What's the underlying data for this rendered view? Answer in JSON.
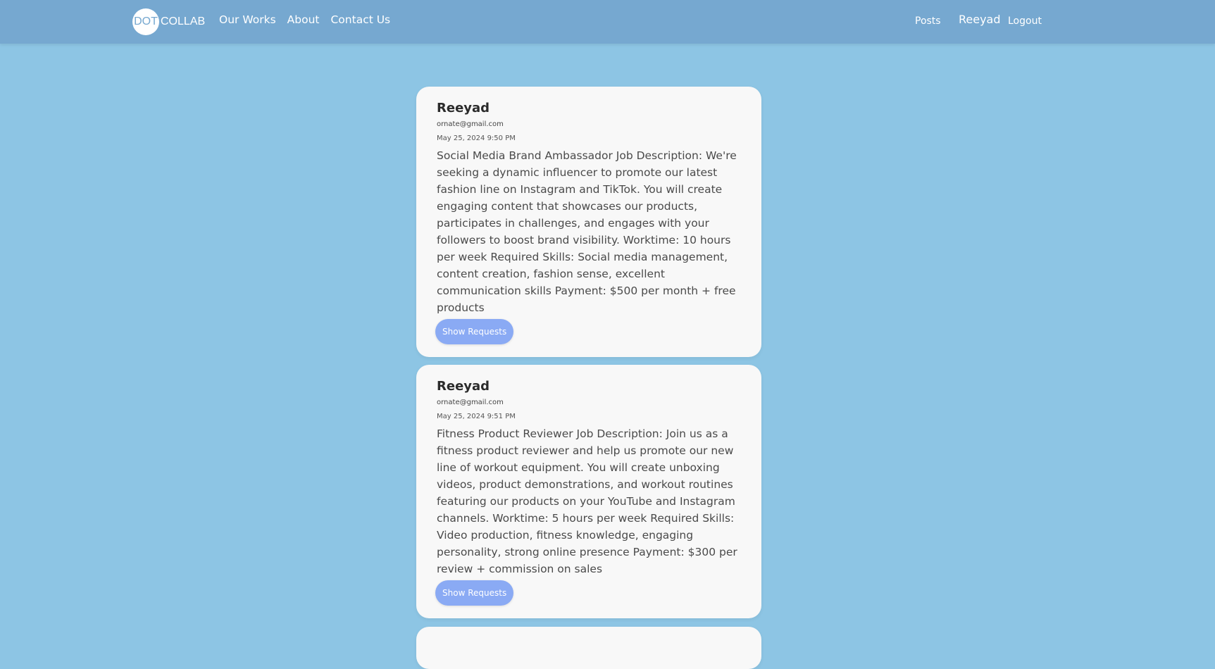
{
  "navbar": {
    "brand_circle": "DOT",
    "brand_text": "COLLAB",
    "links": [
      "Our Works",
      "About",
      "Contact Us"
    ],
    "posts_label": "Posts",
    "user_name": "Reeyad",
    "logout_label": "Logout"
  },
  "posts": [
    {
      "author": "Reeyad",
      "email": "ornate@gmail.com",
      "date": "May 25, 2024 9:50 PM",
      "body": "Social Media Brand Ambassador Job Description: We're seeking a dynamic influencer to promote our latest fashion line on Instagram and TikTok. You will create engaging content that showcases our products, participates in challenges, and engages with your followers to boost brand visibility. Worktime: 10 hours per week Required Skills: Social media management, content creation, fashion sense, excellent communication skills Payment: $500 per month + free products",
      "button_label": "Show Requests"
    },
    {
      "author": "Reeyad",
      "email": "ornate@gmail.com",
      "date": "May 25, 2024 9:51 PM",
      "body": "Fitness Product Reviewer Job Description: Join us as a fitness product reviewer and help us promote our new line of workout equipment. You will create unboxing videos, product demonstrations, and workout routines featuring our products on your YouTube and Instagram channels. Worktime: 5 hours per week Required Skills: Video production, fitness knowledge, engaging personality, strong online presence Payment: $300 per review + commission on sales",
      "button_label": "Show Requests"
    }
  ]
}
